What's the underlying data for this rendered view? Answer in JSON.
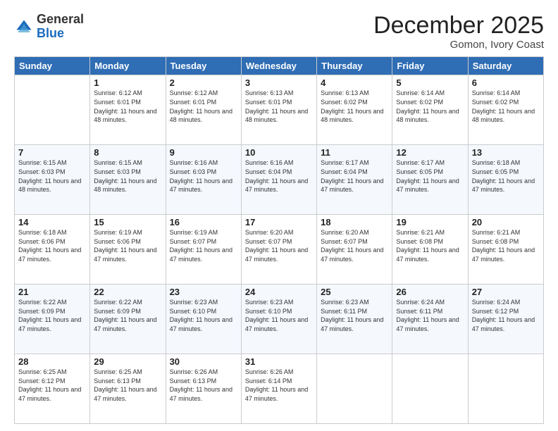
{
  "header": {
    "logo": {
      "general": "General",
      "blue": "Blue"
    },
    "title": "December 2025",
    "location": "Gomon, Ivory Coast"
  },
  "weekdays": [
    "Sunday",
    "Monday",
    "Tuesday",
    "Wednesday",
    "Thursday",
    "Friday",
    "Saturday"
  ],
  "weeks": [
    [
      {
        "day": "",
        "sunrise": "",
        "sunset": "",
        "daylight": "",
        "empty": true
      },
      {
        "day": "1",
        "sunrise": "Sunrise: 6:12 AM",
        "sunset": "Sunset: 6:01 PM",
        "daylight": "Daylight: 11 hours and 48 minutes."
      },
      {
        "day": "2",
        "sunrise": "Sunrise: 6:12 AM",
        "sunset": "Sunset: 6:01 PM",
        "daylight": "Daylight: 11 hours and 48 minutes."
      },
      {
        "day": "3",
        "sunrise": "Sunrise: 6:13 AM",
        "sunset": "Sunset: 6:01 PM",
        "daylight": "Daylight: 11 hours and 48 minutes."
      },
      {
        "day": "4",
        "sunrise": "Sunrise: 6:13 AM",
        "sunset": "Sunset: 6:02 PM",
        "daylight": "Daylight: 11 hours and 48 minutes."
      },
      {
        "day": "5",
        "sunrise": "Sunrise: 6:14 AM",
        "sunset": "Sunset: 6:02 PM",
        "daylight": "Daylight: 11 hours and 48 minutes."
      },
      {
        "day": "6",
        "sunrise": "Sunrise: 6:14 AM",
        "sunset": "Sunset: 6:02 PM",
        "daylight": "Daylight: 11 hours and 48 minutes."
      }
    ],
    [
      {
        "day": "7",
        "sunrise": "Sunrise: 6:15 AM",
        "sunset": "Sunset: 6:03 PM",
        "daylight": "Daylight: 11 hours and 48 minutes."
      },
      {
        "day": "8",
        "sunrise": "Sunrise: 6:15 AM",
        "sunset": "Sunset: 6:03 PM",
        "daylight": "Daylight: 11 hours and 48 minutes."
      },
      {
        "day": "9",
        "sunrise": "Sunrise: 6:16 AM",
        "sunset": "Sunset: 6:03 PM",
        "daylight": "Daylight: 11 hours and 47 minutes."
      },
      {
        "day": "10",
        "sunrise": "Sunrise: 6:16 AM",
        "sunset": "Sunset: 6:04 PM",
        "daylight": "Daylight: 11 hours and 47 minutes."
      },
      {
        "day": "11",
        "sunrise": "Sunrise: 6:17 AM",
        "sunset": "Sunset: 6:04 PM",
        "daylight": "Daylight: 11 hours and 47 minutes."
      },
      {
        "day": "12",
        "sunrise": "Sunrise: 6:17 AM",
        "sunset": "Sunset: 6:05 PM",
        "daylight": "Daylight: 11 hours and 47 minutes."
      },
      {
        "day": "13",
        "sunrise": "Sunrise: 6:18 AM",
        "sunset": "Sunset: 6:05 PM",
        "daylight": "Daylight: 11 hours and 47 minutes."
      }
    ],
    [
      {
        "day": "14",
        "sunrise": "Sunrise: 6:18 AM",
        "sunset": "Sunset: 6:06 PM",
        "daylight": "Daylight: 11 hours and 47 minutes."
      },
      {
        "day": "15",
        "sunrise": "Sunrise: 6:19 AM",
        "sunset": "Sunset: 6:06 PM",
        "daylight": "Daylight: 11 hours and 47 minutes."
      },
      {
        "day": "16",
        "sunrise": "Sunrise: 6:19 AM",
        "sunset": "Sunset: 6:07 PM",
        "daylight": "Daylight: 11 hours and 47 minutes."
      },
      {
        "day": "17",
        "sunrise": "Sunrise: 6:20 AM",
        "sunset": "Sunset: 6:07 PM",
        "daylight": "Daylight: 11 hours and 47 minutes."
      },
      {
        "day": "18",
        "sunrise": "Sunrise: 6:20 AM",
        "sunset": "Sunset: 6:07 PM",
        "daylight": "Daylight: 11 hours and 47 minutes."
      },
      {
        "day": "19",
        "sunrise": "Sunrise: 6:21 AM",
        "sunset": "Sunset: 6:08 PM",
        "daylight": "Daylight: 11 hours and 47 minutes."
      },
      {
        "day": "20",
        "sunrise": "Sunrise: 6:21 AM",
        "sunset": "Sunset: 6:08 PM",
        "daylight": "Daylight: 11 hours and 47 minutes."
      }
    ],
    [
      {
        "day": "21",
        "sunrise": "Sunrise: 6:22 AM",
        "sunset": "Sunset: 6:09 PM",
        "daylight": "Daylight: 11 hours and 47 minutes."
      },
      {
        "day": "22",
        "sunrise": "Sunrise: 6:22 AM",
        "sunset": "Sunset: 6:09 PM",
        "daylight": "Daylight: 11 hours and 47 minutes."
      },
      {
        "day": "23",
        "sunrise": "Sunrise: 6:23 AM",
        "sunset": "Sunset: 6:10 PM",
        "daylight": "Daylight: 11 hours and 47 minutes."
      },
      {
        "day": "24",
        "sunrise": "Sunrise: 6:23 AM",
        "sunset": "Sunset: 6:10 PM",
        "daylight": "Daylight: 11 hours and 47 minutes."
      },
      {
        "day": "25",
        "sunrise": "Sunrise: 6:23 AM",
        "sunset": "Sunset: 6:11 PM",
        "daylight": "Daylight: 11 hours and 47 minutes."
      },
      {
        "day": "26",
        "sunrise": "Sunrise: 6:24 AM",
        "sunset": "Sunset: 6:11 PM",
        "daylight": "Daylight: 11 hours and 47 minutes."
      },
      {
        "day": "27",
        "sunrise": "Sunrise: 6:24 AM",
        "sunset": "Sunset: 6:12 PM",
        "daylight": "Daylight: 11 hours and 47 minutes."
      }
    ],
    [
      {
        "day": "28",
        "sunrise": "Sunrise: 6:25 AM",
        "sunset": "Sunset: 6:12 PM",
        "daylight": "Daylight: 11 hours and 47 minutes."
      },
      {
        "day": "29",
        "sunrise": "Sunrise: 6:25 AM",
        "sunset": "Sunset: 6:13 PM",
        "daylight": "Daylight: 11 hours and 47 minutes."
      },
      {
        "day": "30",
        "sunrise": "Sunrise: 6:26 AM",
        "sunset": "Sunset: 6:13 PM",
        "daylight": "Daylight: 11 hours and 47 minutes."
      },
      {
        "day": "31",
        "sunrise": "Sunrise: 6:26 AM",
        "sunset": "Sunset: 6:14 PM",
        "daylight": "Daylight: 11 hours and 47 minutes."
      },
      {
        "day": "",
        "sunrise": "",
        "sunset": "",
        "daylight": "",
        "empty": true
      },
      {
        "day": "",
        "sunrise": "",
        "sunset": "",
        "daylight": "",
        "empty": true
      },
      {
        "day": "",
        "sunrise": "",
        "sunset": "",
        "daylight": "",
        "empty": true
      }
    ]
  ]
}
